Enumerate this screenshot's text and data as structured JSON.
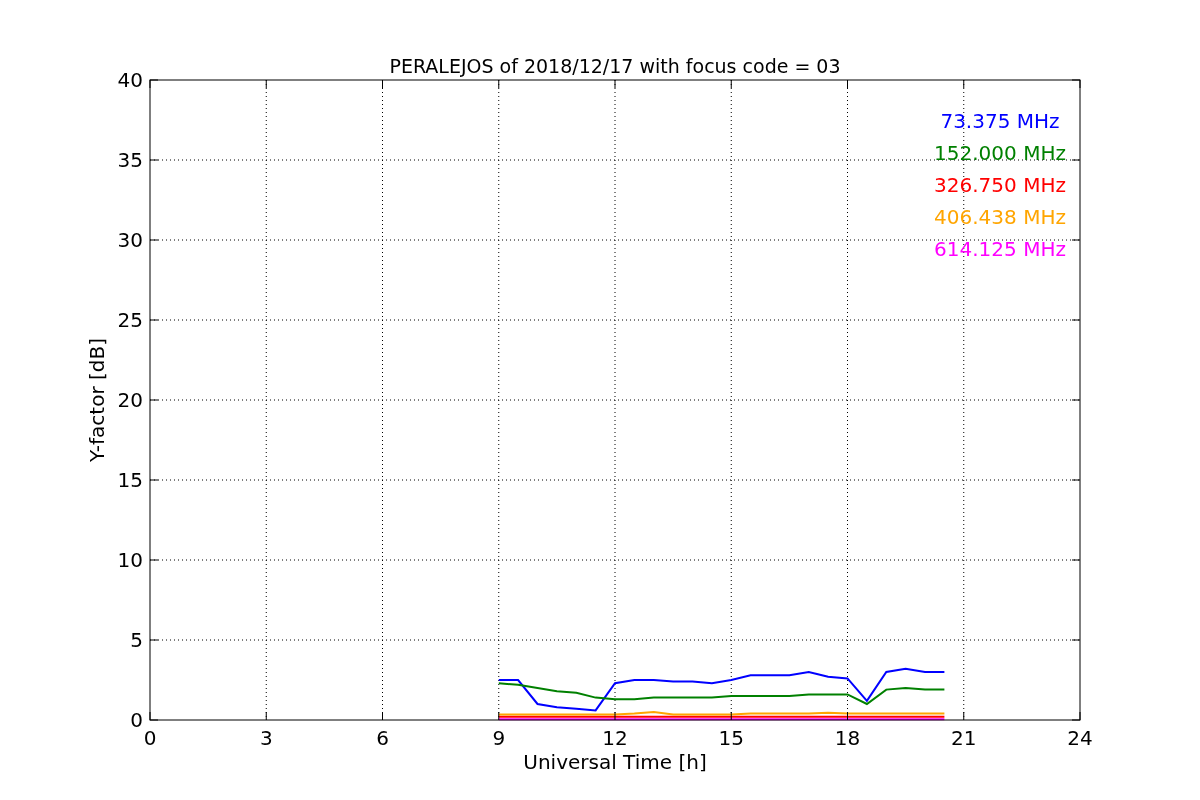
{
  "chart_data": {
    "type": "line",
    "title": "PERALEJOS of 2018/12/17 with focus code = 03",
    "xlabel": "Universal Time [h]",
    "ylabel": "Y-factor [dB]",
    "x": [
      9,
      9.5,
      10,
      10.5,
      11,
      11.5,
      12,
      12.5,
      13,
      13.5,
      14,
      14.5,
      15,
      15.5,
      16,
      16.5,
      17,
      17.5,
      18,
      18.5,
      19,
      19.5,
      20,
      20.5
    ],
    "series": [
      {
        "name": "73.375 MHz",
        "color": "#0000ff",
        "values": [
          2.5,
          2.5,
          1.0,
          0.8,
          0.7,
          0.6,
          2.3,
          2.5,
          2.5,
          2.4,
          2.4,
          2.3,
          2.5,
          2.8,
          2.8,
          2.8,
          3.0,
          2.7,
          2.6,
          1.2,
          3.0,
          3.2,
          3.0,
          3.0
        ]
      },
      {
        "name": "152.000 MHz",
        "color": "#008000",
        "values": [
          2.3,
          2.2,
          2.0,
          1.8,
          1.7,
          1.4,
          1.3,
          1.3,
          1.4,
          1.4,
          1.4,
          1.4,
          1.5,
          1.5,
          1.5,
          1.5,
          1.6,
          1.6,
          1.6,
          1.0,
          1.9,
          2.0,
          1.9,
          1.9
        ]
      },
      {
        "name": "326.750 MHz",
        "color": "#ff0000",
        "values": [
          0.2,
          0.2,
          0.2,
          0.2,
          0.2,
          0.2,
          0.2,
          0.2,
          0.2,
          0.2,
          0.2,
          0.2,
          0.2,
          0.2,
          0.2,
          0.2,
          0.2,
          0.2,
          0.2,
          0.2,
          0.2,
          0.2,
          0.2,
          0.2
        ]
      },
      {
        "name": "406.438 MHz",
        "color": "#ffa500",
        "values": [
          0.35,
          0.35,
          0.35,
          0.35,
          0.35,
          0.35,
          0.35,
          0.4,
          0.5,
          0.35,
          0.35,
          0.35,
          0.35,
          0.4,
          0.4,
          0.4,
          0.4,
          0.45,
          0.4,
          0.4,
          0.4,
          0.4,
          0.4,
          0.4
        ]
      },
      {
        "name": "614.125 MHz",
        "color": "#ff00ff",
        "values": [
          0.05,
          0.05,
          0.05,
          0.05,
          0.05,
          0.05,
          0.05,
          0.05,
          0.05,
          0.05,
          0.05,
          0.05,
          0.05,
          0.05,
          0.05,
          0.05,
          0.05,
          0.05,
          0.05,
          0.05,
          0.05,
          0.05,
          0.05,
          0.05
        ]
      }
    ],
    "grid": true,
    "xlim": [
      0,
      24
    ],
    "ylim": [
      0,
      40
    ],
    "xticks": [
      0,
      3,
      6,
      9,
      12,
      15,
      18,
      21,
      24
    ],
    "yticks": [
      0,
      5,
      10,
      15,
      20,
      25,
      30,
      35,
      40
    ]
  }
}
